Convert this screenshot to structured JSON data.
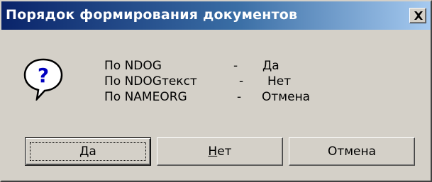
{
  "window": {
    "title": "Порядок формирования документов",
    "close_icon": "close-icon"
  },
  "message": {
    "icon": "question-icon",
    "rows": [
      {
        "key": "По NDOG",
        "dash": "-",
        "value": "Да"
      },
      {
        "key": "По NDOGтекст",
        "dash": "-",
        "value": "Нет"
      },
      {
        "key": "По NAMEORG",
        "dash": "-",
        "value": "Отмена"
      }
    ]
  },
  "buttons": {
    "yes": {
      "accel": "Д",
      "rest": "а"
    },
    "no": {
      "accel": "Н",
      "rest": "ет"
    },
    "cancel": {
      "label": "Отмена"
    }
  },
  "colors": {
    "titlebar_start": "#0a246a",
    "titlebar_end": "#a6caf0",
    "face": "#d4d0c8"
  }
}
